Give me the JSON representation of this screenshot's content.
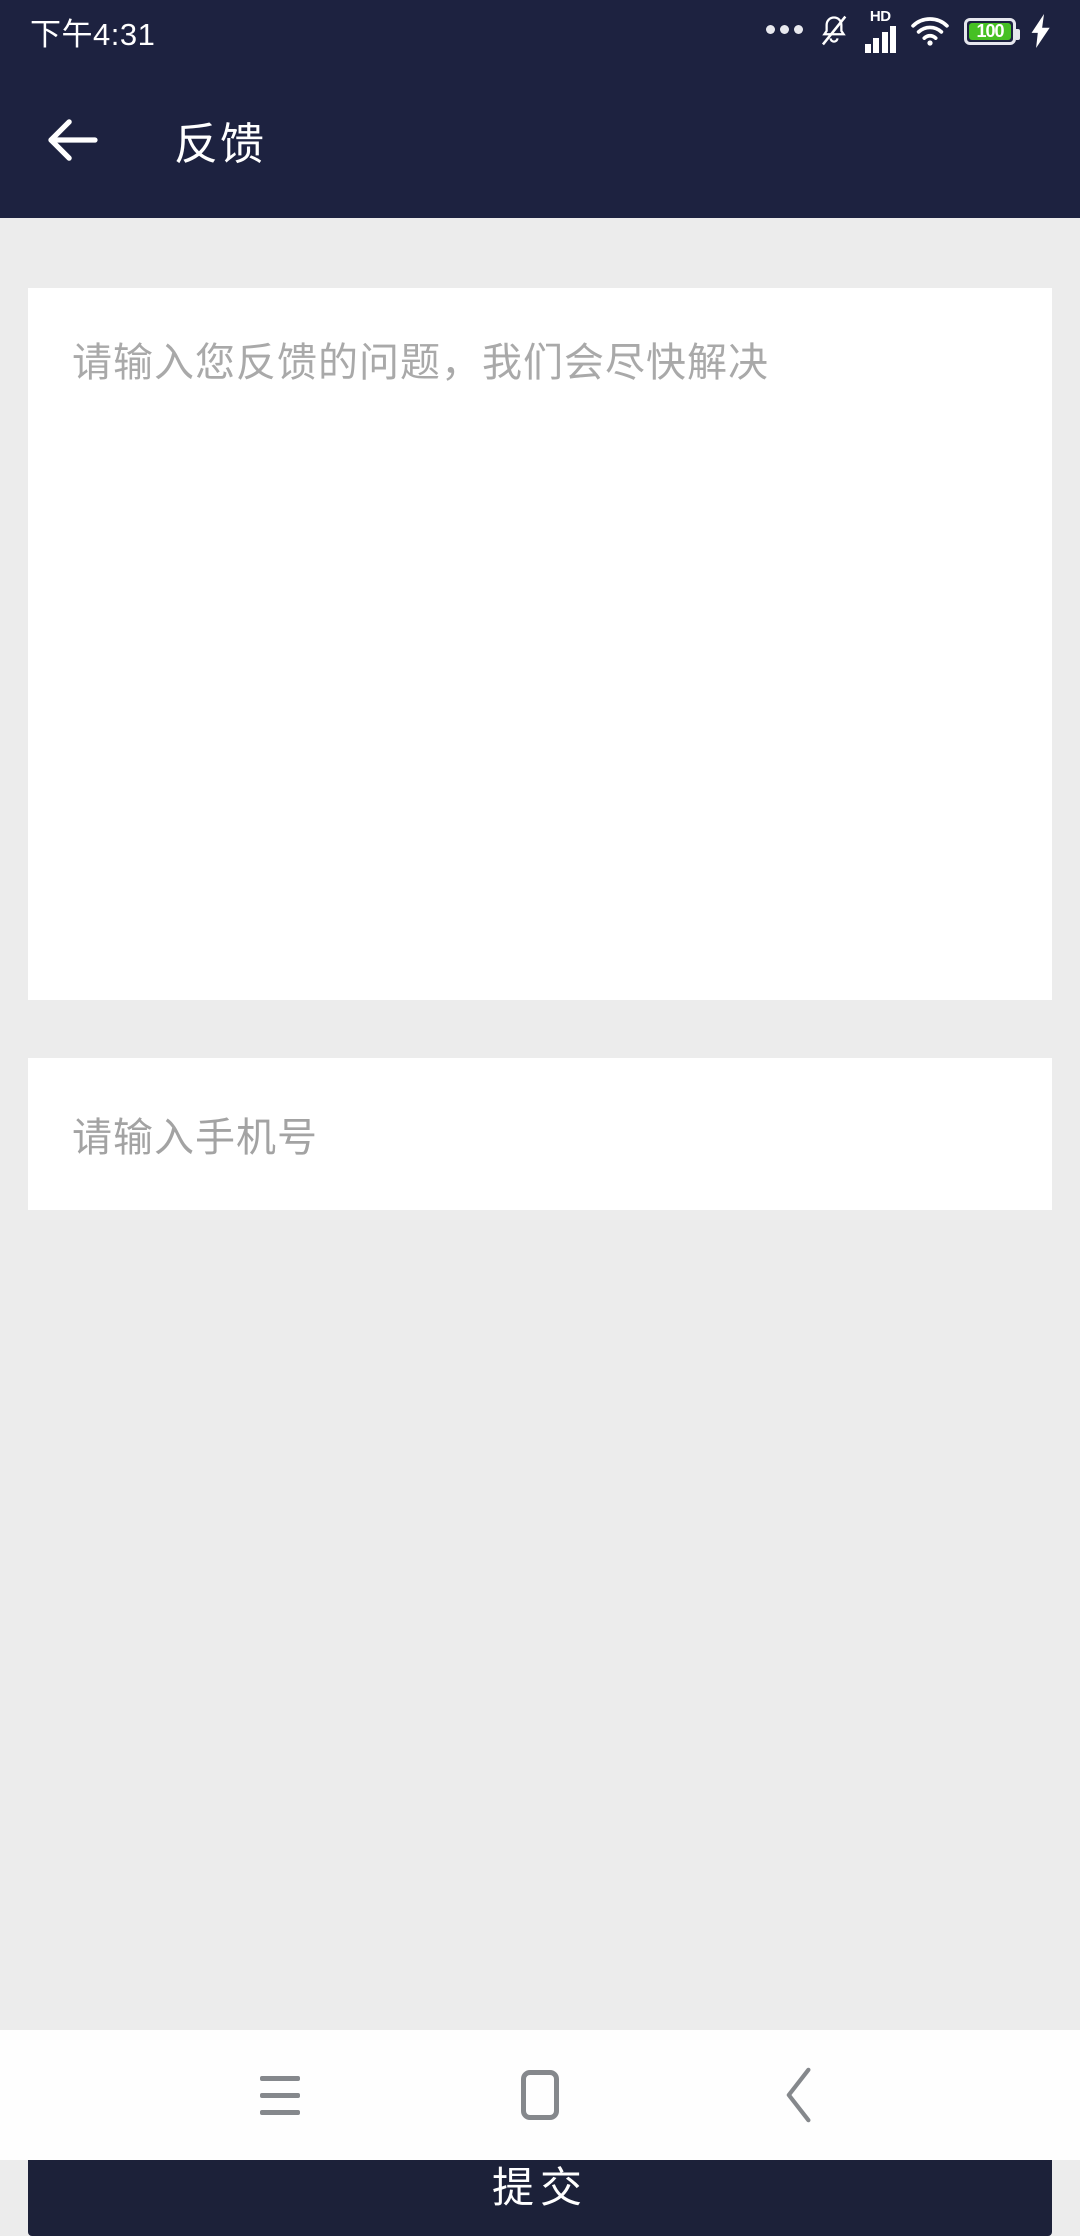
{
  "status_bar": {
    "clock": "下午4:31",
    "icons": [
      {
        "name": "more-dots-icon",
        "label": "•••"
      },
      {
        "name": "bell-muted-icon",
        "label": "silent"
      },
      {
        "name": "hd-icon",
        "label": "HD"
      },
      {
        "name": "signal-bars-icon",
        "label": "signal"
      },
      {
        "name": "wifi-icon",
        "label": "wifi"
      },
      {
        "name": "battery-icon",
        "label": "100"
      },
      {
        "name": "charging-bolt-icon",
        "label": "charging"
      }
    ],
    "battery_level": "100",
    "battery_color": "#46c023",
    "background": "#1d2240"
  },
  "header": {
    "title": "反馈",
    "back_icon": "arrow-left-icon",
    "background": "#1d2240",
    "text_color": "#ffffff"
  },
  "form": {
    "feedback": {
      "placeholder": "请输入您反馈的问题，我们会尽快解决",
      "value": ""
    },
    "phone": {
      "placeholder": "请输入手机号",
      "value": ""
    }
  },
  "actions": {
    "submit_label": "提交",
    "submit_color": "#1c2139"
  },
  "system_nav": {
    "menu_icon": "menu-icon",
    "home_icon": "home-square-icon",
    "back_icon": "chevron-left-icon"
  },
  "theme": {
    "page_background": "#ececec",
    "card_background": "#ffffff",
    "placeholder_color": "#a9a9a9",
    "accent": "#1d2240"
  }
}
